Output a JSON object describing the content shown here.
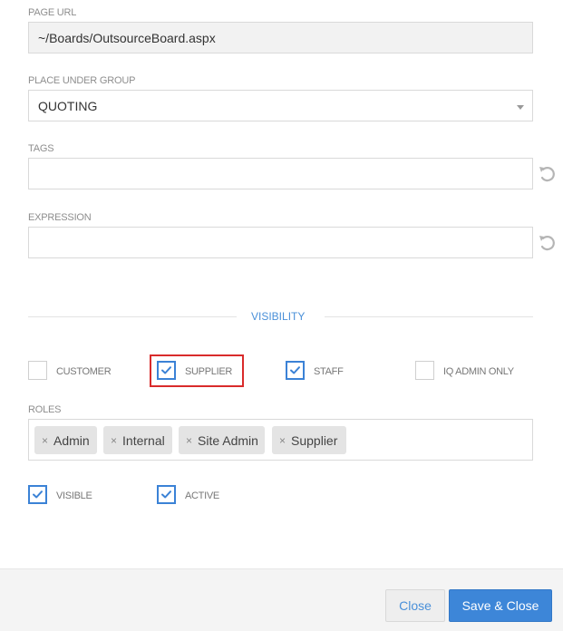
{
  "page_url": {
    "label": "PAGE URL",
    "value": "~/Boards/OutsourceBoard.aspx"
  },
  "group": {
    "label": "PLACE UNDER GROUP",
    "value": "QUOTING"
  },
  "tags": {
    "label": "TAGS",
    "value": ""
  },
  "expression": {
    "label": "EXPRESSION",
    "value": ""
  },
  "visibility": {
    "title": "VISIBILITY",
    "options": [
      {
        "label": "CUSTOMER",
        "checked": false
      },
      {
        "label": "SUPPLIER",
        "checked": true,
        "highlighted": true
      },
      {
        "label": "STAFF",
        "checked": true
      },
      {
        "label": "IQ ADMIN ONLY",
        "checked": false
      }
    ]
  },
  "roles": {
    "label": "ROLES",
    "items": [
      "Admin",
      "Internal",
      "Site Admin",
      "Supplier"
    ],
    "remove_symbol": "×"
  },
  "flags": {
    "visible": {
      "label": "VISIBLE",
      "checked": true
    },
    "active": {
      "label": "ACTIVE",
      "checked": true
    }
  },
  "footer": {
    "close_label": "Close",
    "save_label": "Save & Close"
  },
  "colors": {
    "accent": "#3b82d6",
    "highlight": "#d92b2b"
  },
  "icons": {
    "reset": "undo-icon",
    "check": "check-icon",
    "dropdown": "chevron-down-icon"
  }
}
